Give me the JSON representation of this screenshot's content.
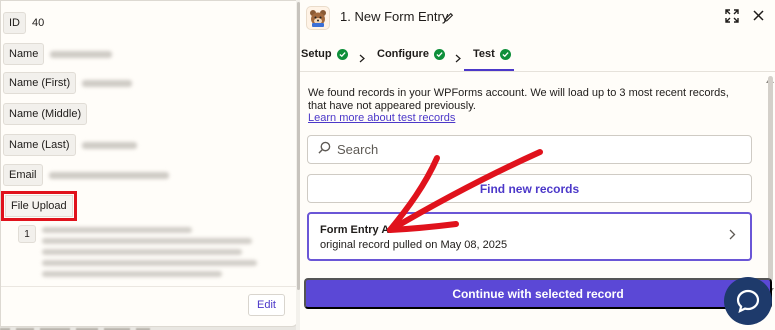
{
  "left_panel": {
    "fields": [
      {
        "label": "ID",
        "value": "40"
      },
      {
        "label": "Name",
        "value": ""
      },
      {
        "label": "Name (First)",
        "value": ""
      },
      {
        "label": "Name (Middle)",
        "value": ""
      },
      {
        "label": "Name (Last)",
        "value": ""
      },
      {
        "label": "Email",
        "value": ""
      },
      {
        "label": "File Upload",
        "value": ""
      }
    ],
    "sub_item_index": "1",
    "edit_label": "Edit"
  },
  "header": {
    "title": "1. New Form Entry",
    "app_icon": "wpforms-bear-logo-icon"
  },
  "tabs": [
    {
      "label": "Setup",
      "complete": true
    },
    {
      "label": "Configure",
      "complete": true
    },
    {
      "label": "Test",
      "complete": true,
      "active": true
    }
  ],
  "info": {
    "text": "We found records in your WPForms account. We will load up to 3 most recent records, that have not appeared previously.",
    "link": "Learn more about test records"
  },
  "search": {
    "placeholder": "Search"
  },
  "find_button": "Find new records",
  "record": {
    "title": "Form Entry A",
    "subtitle": "original record pulled on May 08, 2025"
  },
  "continue_button": "Continue with selected record",
  "colors": {
    "accent": "#5b48d6",
    "check": "#0e8f3a",
    "annotation": "#e0121c"
  }
}
